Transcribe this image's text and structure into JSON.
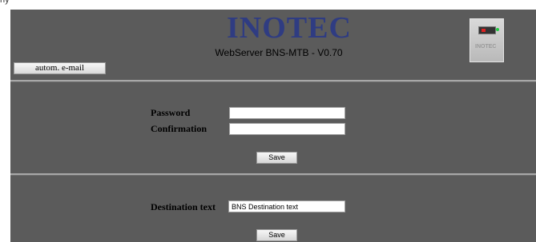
{
  "header": {
    "brand": "INOTEC",
    "subtitle": "WebServer BNS-MTB - V0.70",
    "device_icon": "inotec-device-icon",
    "device_mark": "INOTEC",
    "top_strip_text": "ny"
  },
  "nav": {
    "autom_email_label": "autom. e-mail"
  },
  "password_form": {
    "password_label": "Password",
    "password_value": "",
    "confirmation_label": "Confirmation",
    "confirmation_value": "",
    "save_label": "Save"
  },
  "destination_form": {
    "destination_label": "Destination text",
    "destination_value": "BNS Destination text",
    "save_label": "Save"
  },
  "colors": {
    "background": "#5b5b5b",
    "brand": "#2f3c82",
    "divider": "#a8a8a8"
  }
}
